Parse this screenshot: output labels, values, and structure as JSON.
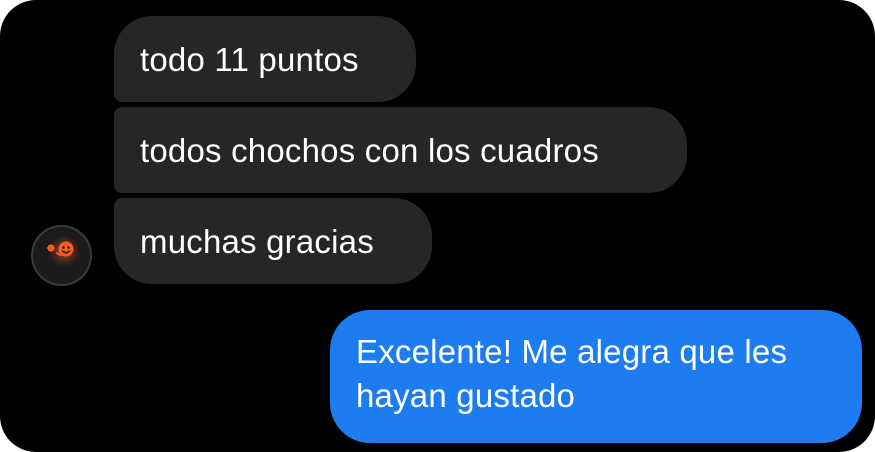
{
  "conversation": {
    "messages": [
      {
        "direction": "incoming",
        "text": "todo 11 puntos"
      },
      {
        "direction": "incoming",
        "text": "todos chochos con los cuadros"
      },
      {
        "direction": "incoming",
        "text": "muchas gracias"
      },
      {
        "direction": "outgoing",
        "text": "Excelente! Me alegra que les hayan gustado"
      }
    ],
    "sender_avatar": {
      "icon": "glowing-smiley-avatar-icon"
    }
  },
  "colors": {
    "background": "#000000",
    "incoming_bubble": "#262626",
    "outgoing_bubble": "#1c7cf0",
    "text": "#ffffff",
    "avatar_glow": "#ff5a1f"
  }
}
